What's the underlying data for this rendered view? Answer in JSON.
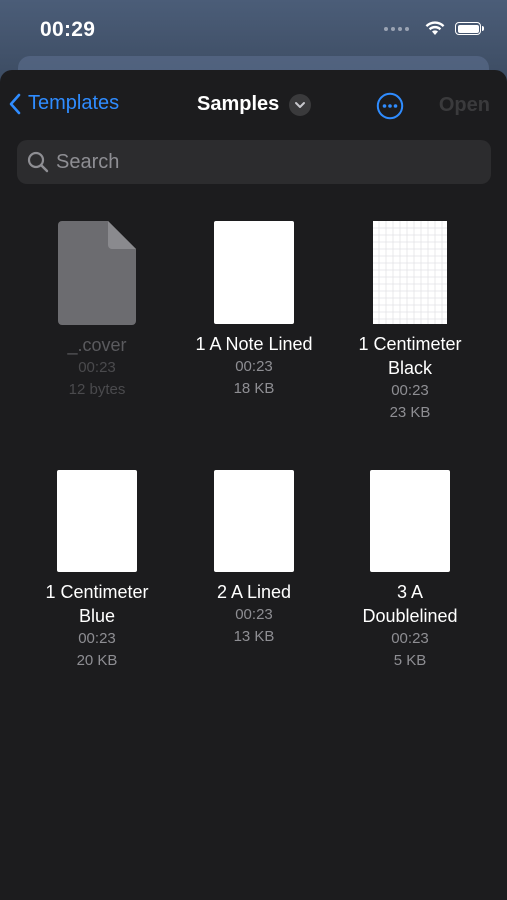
{
  "status": {
    "time": "00:29"
  },
  "nav": {
    "back_label": "Templates",
    "title": "Samples",
    "open_label": "Open"
  },
  "search": {
    "placeholder": "Search"
  },
  "files": [
    {
      "name": "_.cover",
      "time": "00:23",
      "size": "12 bytes",
      "kind": "generic",
      "dimmed": true
    },
    {
      "name": "1 A Note Lined",
      "time": "00:23",
      "size": "18 KB",
      "kind": "page"
    },
    {
      "name": "1 Centimeter Black",
      "time": "00:23",
      "size": "23 KB",
      "kind": "grid"
    },
    {
      "name": "1 Centimeter Blue",
      "time": "00:23",
      "size": "20 KB",
      "kind": "page"
    },
    {
      "name": "2 A Lined",
      "time": "00:23",
      "size": "13 KB",
      "kind": "page"
    },
    {
      "name": "3 A Doublelined",
      "time": "00:23",
      "size": "5 KB",
      "kind": "page"
    }
  ],
  "colors": {
    "accent": "#2f8cff",
    "background": "#1c1c1e",
    "search_bg": "#2c2c2e",
    "secondary_text": "#8e8e93"
  }
}
